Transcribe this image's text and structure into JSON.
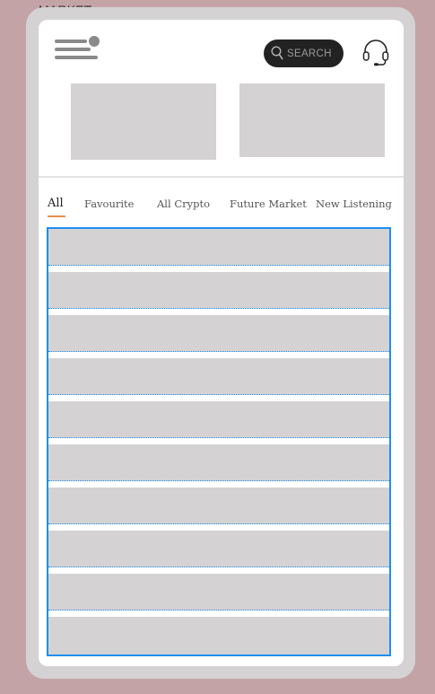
{
  "page": {
    "label": "MARKET"
  },
  "header": {
    "menu_icon": "menu-icon",
    "search": {
      "placeholder": "SEARCH",
      "icon": "search-icon"
    },
    "support_icon": "headset-icon"
  },
  "banners": [
    {
      "name": "banner-1"
    },
    {
      "name": "banner-2"
    }
  ],
  "tabs": [
    {
      "label": "All",
      "active": true
    },
    {
      "label": "Favourite",
      "active": false
    },
    {
      "label": "All Crypto",
      "active": false
    },
    {
      "label": "Future Market",
      "active": false
    },
    {
      "label": "New Listening",
      "active": false
    }
  ],
  "list": {
    "row_count": 10
  },
  "colors": {
    "background": "#c4a3a6",
    "frame": "#d4d2d3",
    "placeholder": "#d4d2d3",
    "search_bg": "#222222",
    "tab_underline": "#e8904a",
    "list_border": "#1d8ff0"
  }
}
